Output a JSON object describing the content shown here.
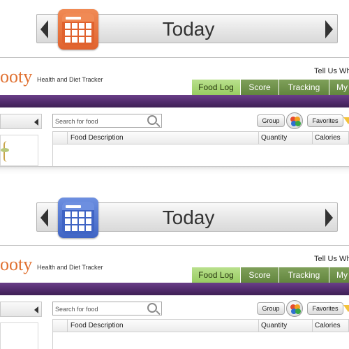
{
  "panels": [
    {
      "today_label": "Today",
      "calendar_color": "#e0622e",
      "calendar_header_color": "#f08a55",
      "app": {
        "logo": "ooty",
        "tagline": "Health and Diet Tracker",
        "tell_us": "Tell Us Wh",
        "tabs": [
          "Food Log",
          "Score",
          "Tracking",
          "My"
        ],
        "active_tab": "Food Log",
        "search_placeholder": "Search for food",
        "group_label": "Group",
        "favorites_label": "Favorites",
        "columns": [
          "Food Description",
          "Quantity",
          "Calories"
        ]
      }
    },
    {
      "today_label": "Today",
      "calendar_color": "#3f64c4",
      "calendar_header_color": "#6d8fe0",
      "app": {
        "logo": "ooty",
        "tagline": "Health and Diet Tracker",
        "tell_us": "Tell Us Wh",
        "tabs": [
          "Food Log",
          "Score",
          "Tracking",
          "My"
        ],
        "active_tab": "Food Log",
        "search_placeholder": "Search for food",
        "group_label": "Group",
        "favorites_label": "Favorites",
        "columns": [
          "Food Description",
          "Quantity",
          "Calories"
        ]
      }
    }
  ],
  "colors": {
    "accent_green": "#98cc62",
    "tab_green": "#62853e",
    "band_purple": "#4f2a6a",
    "logo_orange": "#e07030"
  }
}
